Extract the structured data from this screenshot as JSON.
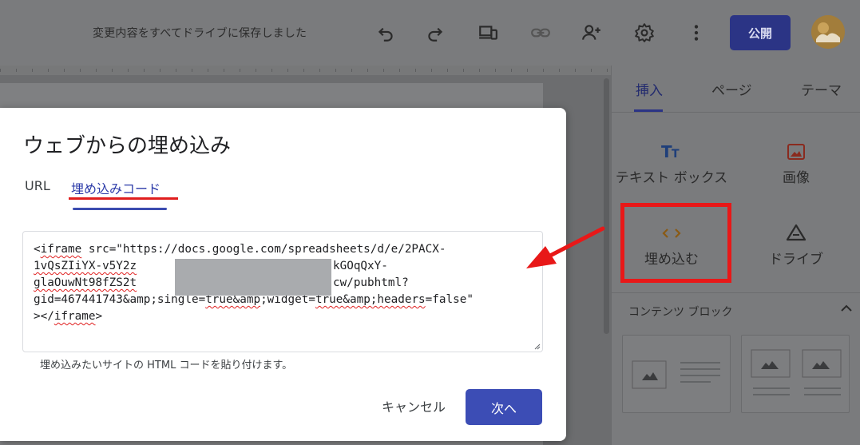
{
  "topbar": {
    "save_status": "変更内容をすべてドライブに保存しました",
    "icons": [
      "undo-icon",
      "redo-icon",
      "device-preview-icon",
      "link-icon",
      "share-icon",
      "settings-icon",
      "more-vert-icon"
    ],
    "publish_label": "公開"
  },
  "panel": {
    "tabs": [
      {
        "label": "挿入",
        "active": true
      },
      {
        "label": "ページ"
      },
      {
        "label": "テーマ"
      }
    ],
    "insert_items": [
      {
        "label": "テキスト ボックス",
        "icon": "text-box-icon"
      },
      {
        "label": "画像",
        "icon": "image-icon"
      },
      {
        "label": "埋め込む",
        "icon": "embed-code-icon"
      },
      {
        "label": "ドライブ",
        "icon": "drive-icon"
      }
    ],
    "content_blocks_title": "コンテンツ ブロック"
  },
  "dialog": {
    "title": "ウェブからの埋め込み",
    "tabs": [
      {
        "label": "URL"
      },
      {
        "label": "埋め込みコード",
        "active": true
      }
    ],
    "code_lines": [
      "<iframe src=\"https://docs.google.com/spreadsheets/d/e/2PACX-",
      "1vQsZIiYX-v5Y2z",
      "kGOqQxY-",
      "glaOuwNt98fZS2t",
      "cw/pubhtml?",
      "gid=467441743&amp;single=true&amp;widget=true&amp;headers=false\"",
      "></iframe>"
    ],
    "helper_text": "埋め込みたいサイトの HTML コードを貼り付けます。",
    "cancel_label": "キャンセル",
    "next_label": "次へ"
  },
  "colors": {
    "accent": "#3c4db5",
    "publish": "#2b3485",
    "annotation_red": "#e81818"
  }
}
